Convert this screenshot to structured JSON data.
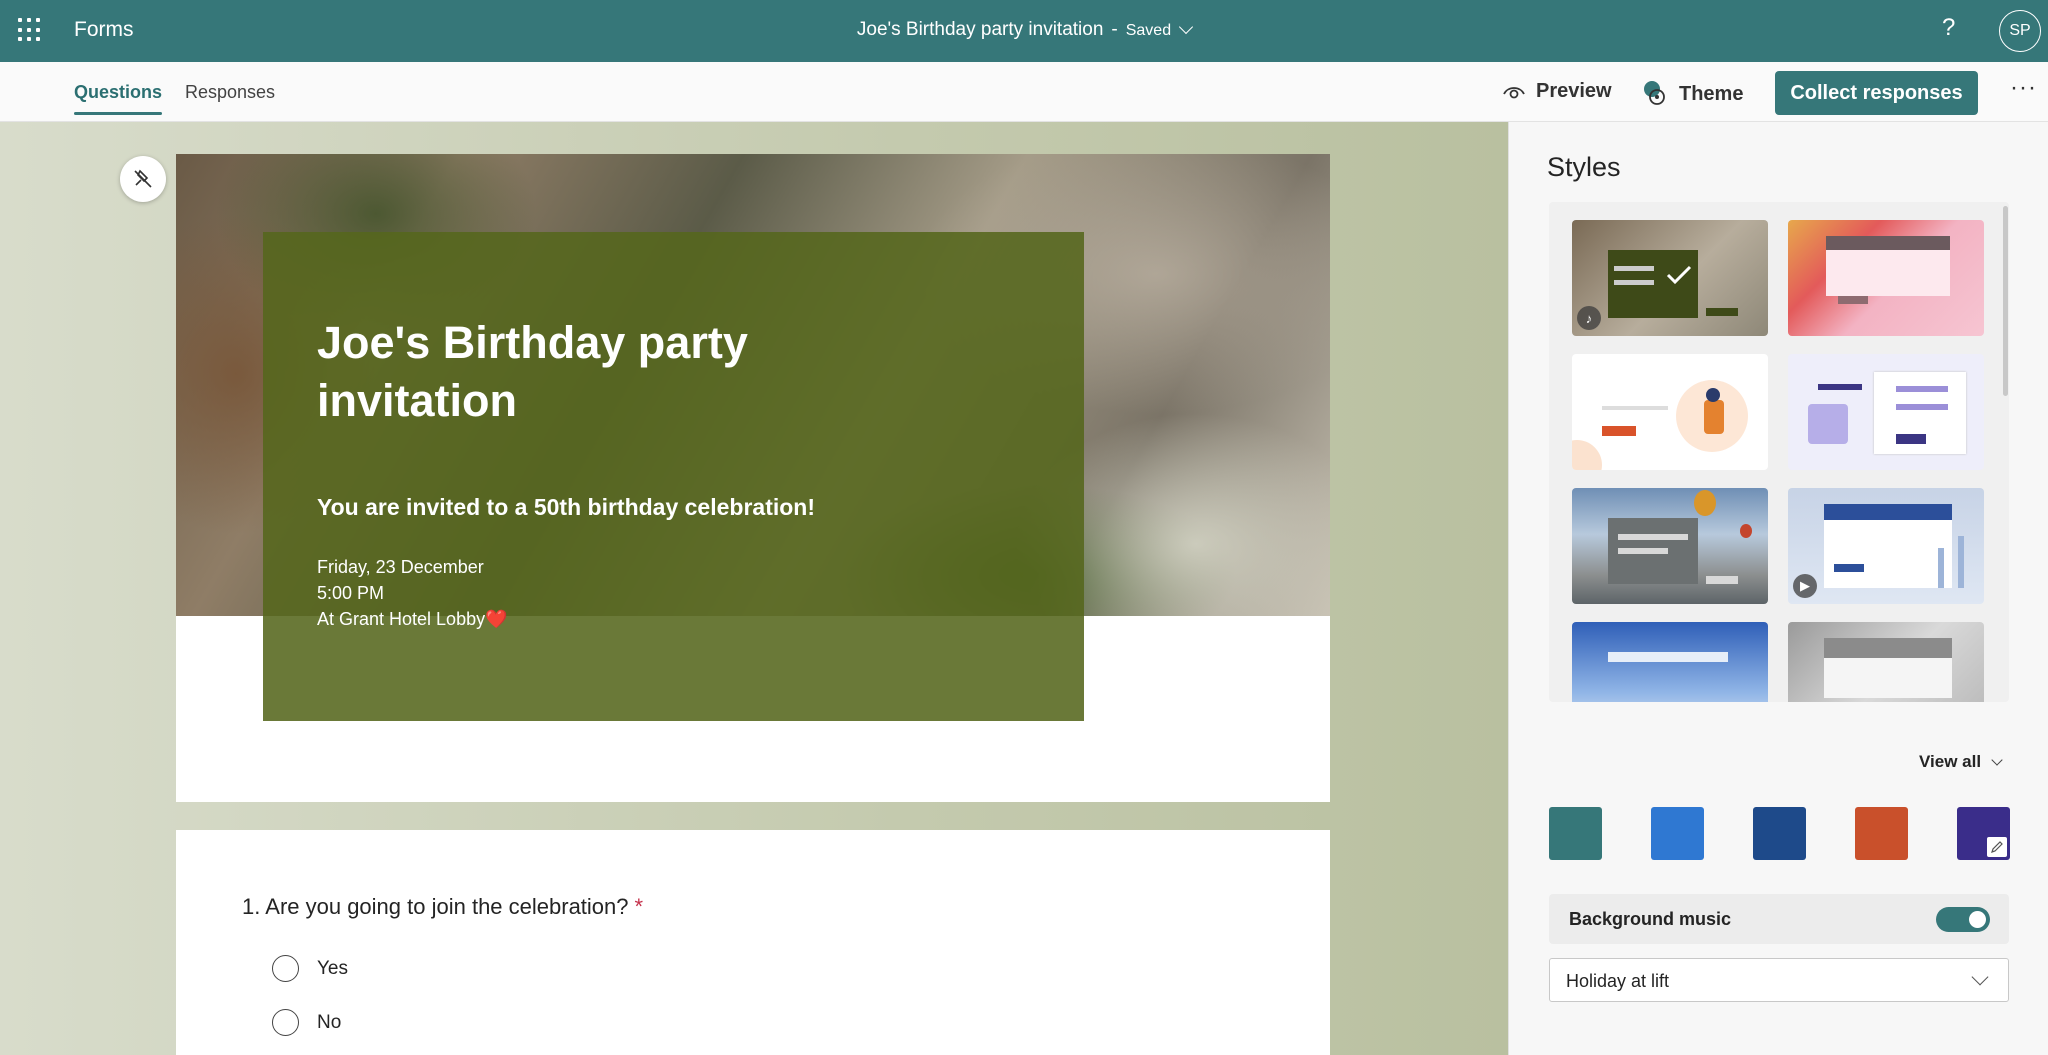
{
  "app": {
    "name": "Forms",
    "title": "Joe's Birthday party invitation",
    "separator": "-",
    "save_status": "Saved",
    "help_label": "?",
    "user_initials": "SP"
  },
  "tabs": [
    {
      "label": "Questions",
      "active": true
    },
    {
      "label": "Responses",
      "active": false
    }
  ],
  "toolbar": {
    "preview_label": "Preview",
    "theme_label": "Theme",
    "collect_label": "Collect responses",
    "more_label": "···"
  },
  "form": {
    "title": "Joe's Birthday party invitation",
    "subtitle": "You are invited to a 50th birthday celebration!",
    "detail_date": "Friday, 23 December",
    "detail_time": "5:00 PM",
    "detail_location": "At Grant Hotel Lobby",
    "detail_emoji": "❤️"
  },
  "question": {
    "number": "1.",
    "text": "Are you going to join the celebration?",
    "required_mark": "*",
    "options": [
      "Yes",
      "No"
    ]
  },
  "styles_pane": {
    "title": "Styles",
    "view_all_label": "View all",
    "swatches": [
      "#367779",
      "#2f78d2",
      "#1e4a8a",
      "#c9502b",
      "#3a2d8a"
    ],
    "background_music_label": "Background music",
    "background_music_on": true,
    "music_selection": "Holiday at lift"
  },
  "colors": {
    "accent": "#367779",
    "title_panel": "#55671c",
    "required": "#c4314b"
  }
}
